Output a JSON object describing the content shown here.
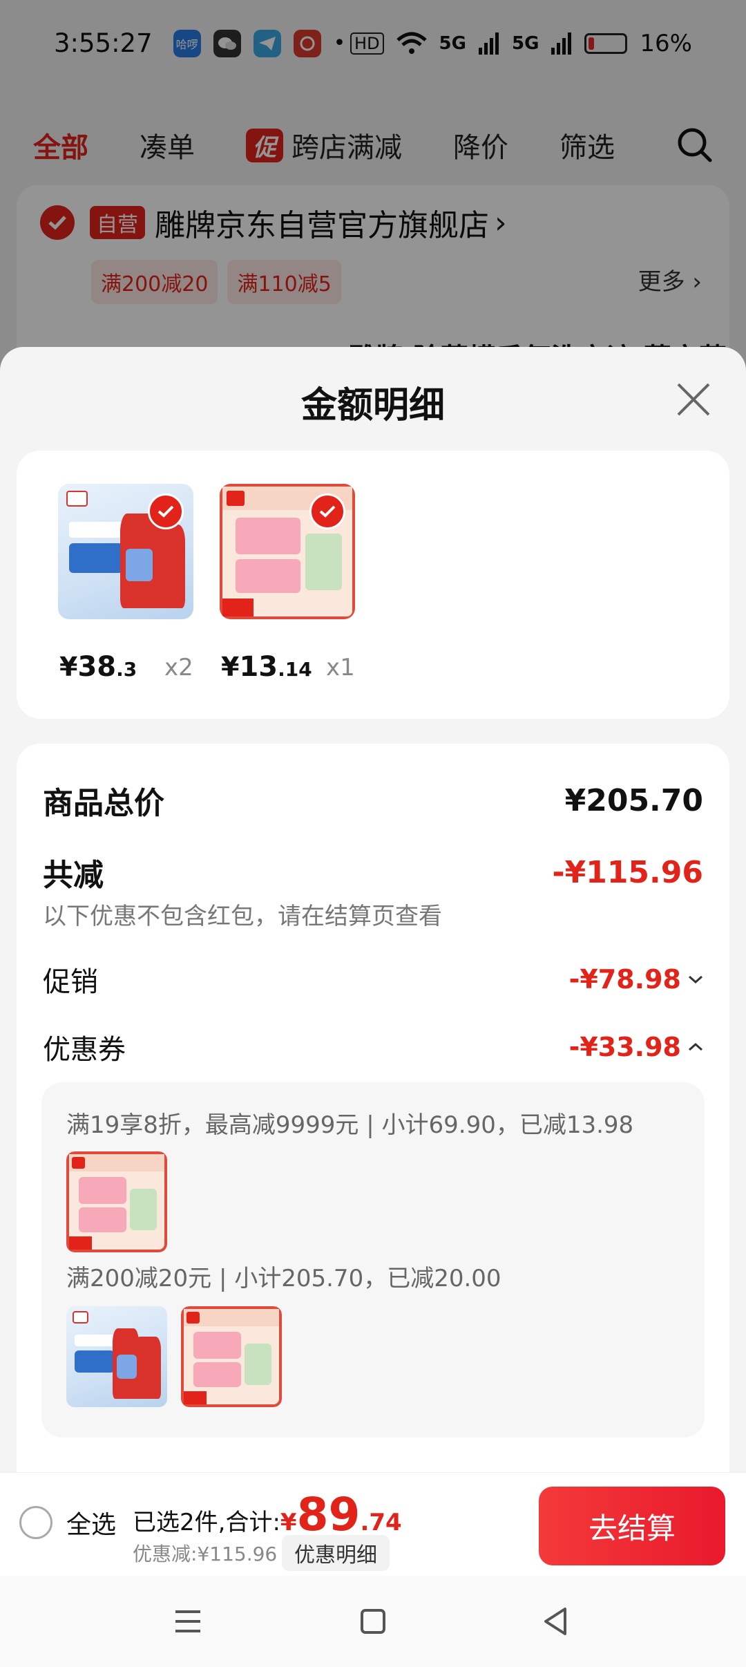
{
  "status_bar": {
    "time": "3:55:27",
    "app_icons": [
      "哈啰",
      "wechat-icon",
      "telegram-icon",
      "bank-icon"
    ],
    "network": "5G",
    "battery": "16%",
    "battery_level": 0.16
  },
  "filter_bar": {
    "items": [
      "全部",
      "凑单",
      "跨店满减",
      "降价",
      "筛选"
    ],
    "promo_badge": "促"
  },
  "store": {
    "badge": "自营",
    "name": "雕牌京东自营官方旗舰店",
    "coupons": [
      "满200减20",
      "满110减5"
    ],
    "more": "更多",
    "product_peek": "雕牌 除菌螨香氛洗衣液 薰衣草"
  },
  "sheet": {
    "title": "金额明细",
    "products": [
      {
        "yen": "¥",
        "price_int": "38",
        "price_dec": ".3",
        "qty": "x2"
      },
      {
        "yen": "¥",
        "price_int": "13",
        "price_dec": ".14",
        "qty": "x1"
      }
    ],
    "summary": {
      "total_label": "商品总价",
      "total_value": "¥205.70",
      "reduce_label": "共减",
      "reduce_value": "-¥115.96",
      "note": "以下优惠不包含红包，请在结算页查看",
      "promo_label": "促销",
      "promo_value": "-¥78.98",
      "coupon_label": "优惠券",
      "coupon_value": "-¥33.98"
    },
    "coupon_details": [
      "满19享8折，最高减9999元 | 小计69.90，已减13.98",
      "满200减20元 | 小计205.70，已减20.00"
    ]
  },
  "bottom_bar": {
    "select_all": "全选",
    "selected_text": "已选2件,合计:",
    "total_yen": "¥",
    "total_int": "89",
    "total_dec": ".74",
    "discount": "优惠减:¥115.96",
    "detail_button": "优惠明细",
    "checkout": "去结算"
  },
  "colors": {
    "accent": "#e2231a"
  }
}
